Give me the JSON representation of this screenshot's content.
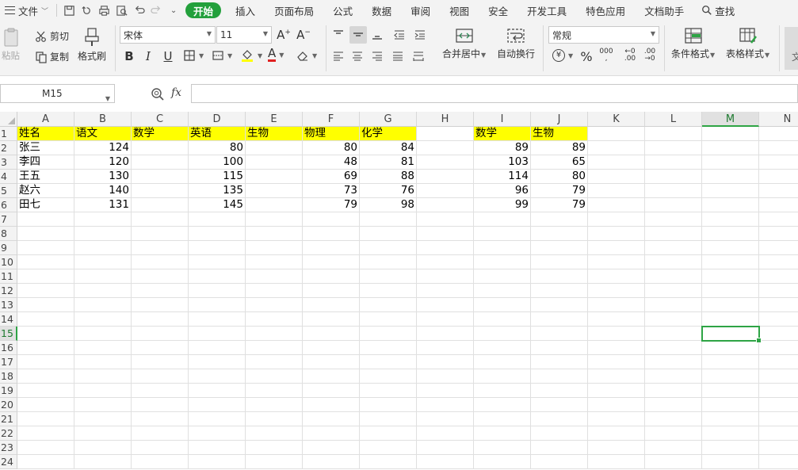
{
  "menubar": {
    "file_label": "文件",
    "tabs": [
      "开始",
      "插入",
      "页面布局",
      "公式",
      "数据",
      "审阅",
      "视图",
      "安全",
      "开发工具",
      "特色应用",
      "文档助手"
    ],
    "active_tab": "开始",
    "search_label": "查找"
  },
  "ribbon": {
    "paste": "粘贴",
    "cut": "剪切",
    "copy": "复制",
    "format_painter": "格式刷",
    "font_name": "宋体",
    "font_size": "11",
    "bold": "B",
    "italic": "I",
    "underline": "U",
    "font_color_letter": "A",
    "merge_center": "合并居中",
    "wrap_text": "自动换行",
    "number_format": "常规",
    "percent": "%",
    "thousands": "000",
    "inc_decimal": ".00",
    "dec_decimal": ".00",
    "conditional_format": "条件格式",
    "table_style": "表格样式",
    "cut_off_label": "文",
    "grow_font": "A",
    "shrink_font": "A",
    "currency_symbol": "¥"
  },
  "formula": {
    "name_box": "M15",
    "fx": "fx",
    "value": ""
  },
  "columns": [
    "A",
    "B",
    "C",
    "D",
    "E",
    "F",
    "G",
    "H",
    "I",
    "J",
    "K",
    "L",
    "M",
    "N"
  ],
  "selected_column": "M",
  "rows": [
    "1",
    "2",
    "3",
    "4",
    "5",
    "6",
    "7",
    "8",
    "9",
    "10",
    "11",
    "12",
    "13",
    "14",
    "15",
    "16",
    "17",
    "18",
    "19",
    "20",
    "21",
    "22",
    "23",
    "24"
  ],
  "selected_row": "15",
  "sheet": {
    "header_row": [
      "姓名",
      "语文",
      "数学",
      "英语",
      "生物",
      "物理",
      "化学",
      "",
      "数学",
      "生物"
    ],
    "data_rows": [
      [
        "张三",
        "124",
        "",
        "80",
        "",
        "80",
        "84",
        "",
        "89",
        "89"
      ],
      [
        "李四",
        "120",
        "",
        "100",
        "",
        "48",
        "81",
        "",
        "103",
        "65"
      ],
      [
        "王五",
        "130",
        "",
        "115",
        "",
        "69",
        "88",
        "",
        "114",
        "80"
      ],
      [
        "赵六",
        "140",
        "",
        "135",
        "",
        "73",
        "76",
        "",
        "96",
        "79"
      ],
      [
        "田七",
        "131",
        "",
        "145",
        "",
        "79",
        "98",
        "",
        "99",
        "79"
      ]
    ]
  },
  "colors": {
    "accent": "#23a03c",
    "header_fill": "#ffff00",
    "selection": "#2ea445"
  }
}
